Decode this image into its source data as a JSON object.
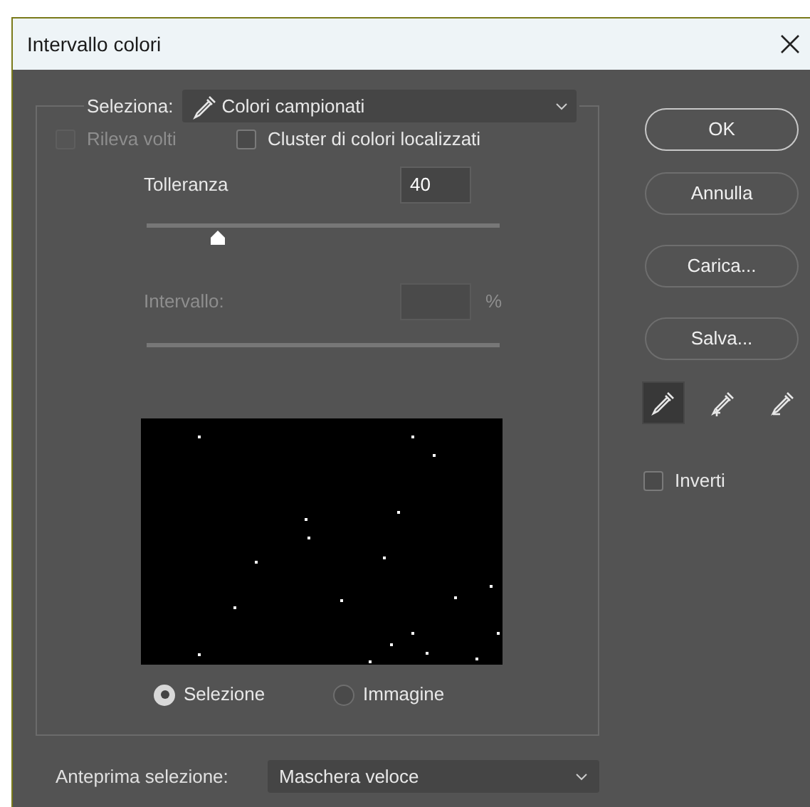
{
  "window": {
    "title": "Intervallo colori"
  },
  "select": {
    "label": "Seleziona:",
    "value": "Colori campionati"
  },
  "options": [
    {
      "label": "Rileva volti",
      "checked": false,
      "disabled": true
    },
    {
      "label": "Cluster di colori localizzati",
      "checked": false,
      "disabled": false
    }
  ],
  "tolerance": {
    "label": "Tolleranza",
    "value": "40",
    "level": 0.2
  },
  "range": {
    "label": "Intervallo:",
    "unit": "%",
    "disabled": true
  },
  "preview_mode": [
    {
      "label": "Selezione",
      "selected": true
    },
    {
      "label": "Immagine",
      "selected": false
    }
  ],
  "selection_preview": {
    "label": "Anteprima selezione:",
    "value": "Maschera veloce"
  },
  "buttons": [
    {
      "label": "OK",
      "default": true
    },
    {
      "label": "Annulla",
      "default": false
    },
    {
      "label": "Carica...",
      "default": false
    },
    {
      "label": "Salva...",
      "default": false
    }
  ],
  "eyedroppers": [
    {
      "kind": "plain",
      "selected": true
    },
    {
      "kind": "add",
      "selected": false
    },
    {
      "kind": "subtract",
      "selected": false
    }
  ],
  "invert": {
    "label": "Inverti",
    "checked": false
  }
}
